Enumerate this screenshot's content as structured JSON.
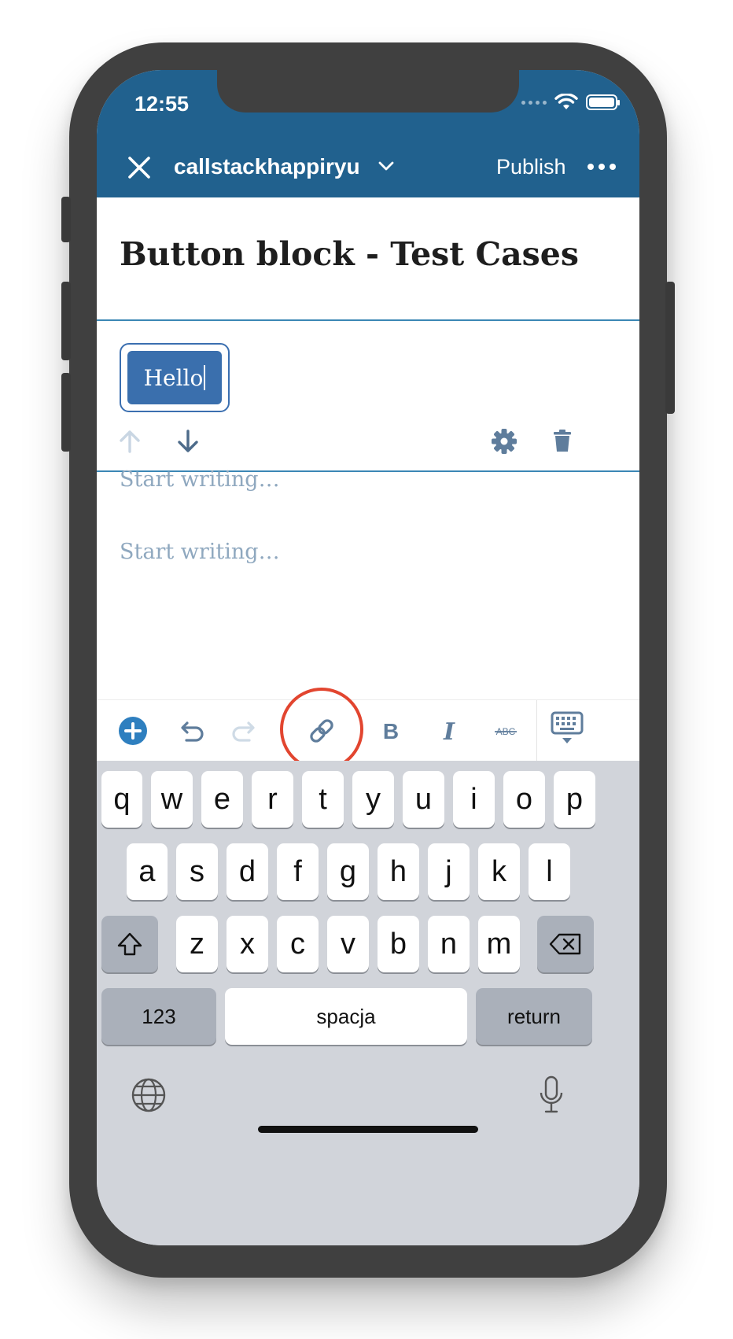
{
  "status_bar": {
    "time": "12:55"
  },
  "nav": {
    "site_title": "callstackhappiryu",
    "publish_label": "Publish"
  },
  "editor": {
    "post_title": "Button block - Test Cases",
    "button_text": "Hello",
    "placeholders": [
      "Start writing…",
      "Start writing…"
    ]
  },
  "keyboard": {
    "row1": [
      "q",
      "w",
      "e",
      "r",
      "t",
      "y",
      "u",
      "i",
      "o",
      "p"
    ],
    "row2": [
      "a",
      "s",
      "d",
      "f",
      "g",
      "h",
      "j",
      "k",
      "l"
    ],
    "row3": [
      "z",
      "x",
      "c",
      "v",
      "b",
      "n",
      "m"
    ],
    "numbers_label": "123",
    "space_label": "spacja",
    "return_label": "return"
  },
  "colors": {
    "brand_blue": "#21618e",
    "button_blue": "#3a6fad",
    "highlight_red": "#e2452f"
  }
}
